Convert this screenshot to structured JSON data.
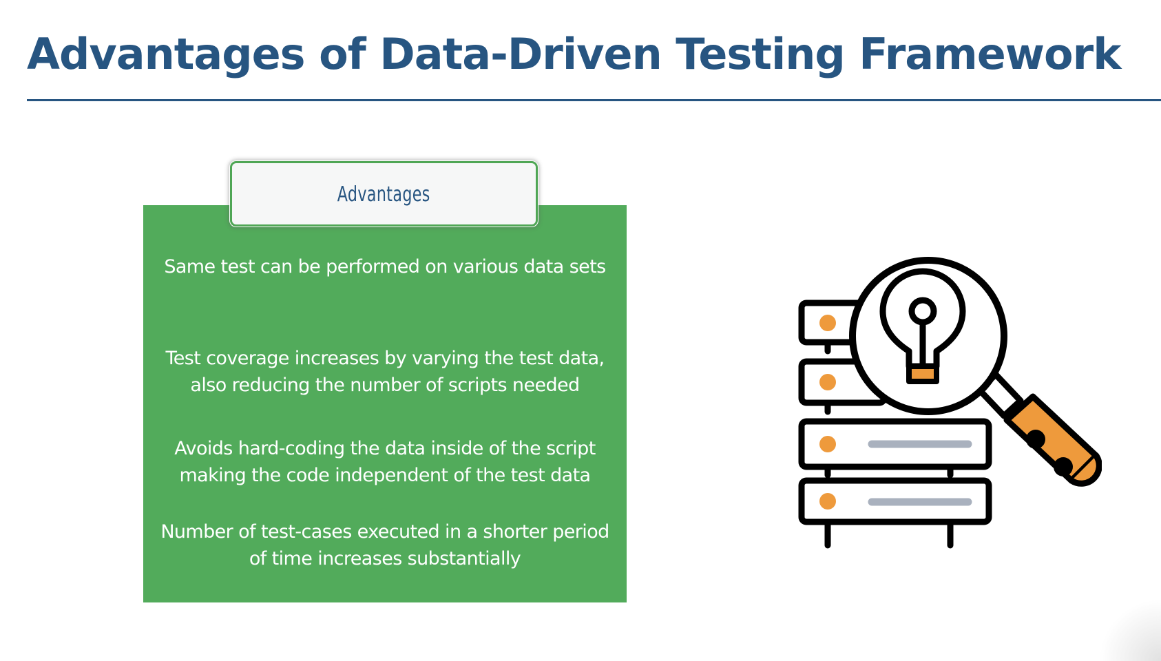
{
  "slide": {
    "title": "Advantages of Data-Driven Testing Framework"
  },
  "advantages": {
    "header": "Advantages",
    "items": [
      "Same test can be performed on various data sets",
      "Test coverage increases by varying the test data, also reducing the number of scripts needed",
      "Avoids hard-coding the data inside of the script making the code independent of the test data",
      "Number of test-cases executed in a shorter period of time increases substantially"
    ]
  },
  "illustration": {
    "icon": "database-search-lightbulb-icon"
  },
  "colors": {
    "title": "#275581",
    "panel": "#52ab5b",
    "header_bg": "#f6f7f7",
    "accent_orange": "#ee9a3c",
    "outline": "#000000",
    "bar_gray": "#a9b1be"
  }
}
